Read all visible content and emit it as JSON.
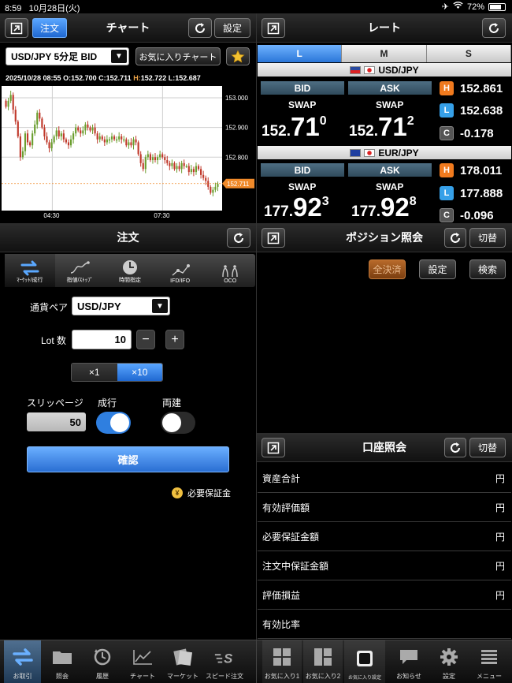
{
  "statusbar": {
    "time": "8:59",
    "date": "10月28日(火)",
    "battery": "72%"
  },
  "chart_panel": {
    "title": "チャート",
    "order_button": "注文",
    "settings_button": "設定",
    "symbol_select": "USD/JPY 5分足 BID",
    "favorite_button": "お気に入りチャート",
    "info": {
      "datetime": "2025/10/28 08:55",
      "o_label": "O:",
      "o_value": "152.700",
      "c_label": "C:",
      "c_value": "152.711",
      "h_label": "H:",
      "h_value": "152.722",
      "l_label": "L:",
      "l_value": "152.687"
    },
    "y_ticks": [
      "153.000",
      "152.900",
      "152.800"
    ],
    "x_ticks": [
      "04:30",
      "07:30"
    ],
    "current_price_tag": "152.711"
  },
  "chart_data": {
    "type": "candlestick",
    "x_ticks": [
      "04:30",
      "07:30"
    ],
    "y_ticks": [
      "153.000",
      "152.900",
      "152.800"
    ],
    "ylim": [
      152.62,
      153.04
    ],
    "current": 152.711,
    "closes": [
      152.97,
      152.99,
      153.01,
      152.96,
      152.92,
      152.87,
      152.8,
      152.82,
      152.88,
      152.85,
      152.84,
      152.88,
      152.91,
      152.95,
      152.93,
      152.9,
      152.87,
      152.85,
      152.83,
      152.85,
      152.87,
      152.89,
      152.87,
      152.88,
      152.86,
      152.85,
      152.84,
      152.86,
      152.88,
      152.9,
      152.89,
      152.88,
      152.89,
      152.91,
      152.9,
      152.89,
      152.9,
      152.88,
      152.86,
      152.87,
      152.86,
      152.85,
      152.86,
      152.86,
      152.87,
      152.86,
      152.86,
      152.87,
      152.86,
      152.86,
      152.84,
      152.85,
      152.84,
      152.86,
      152.85,
      152.81,
      152.78,
      152.76,
      152.8,
      152.81,
      152.79,
      152.8,
      152.79,
      152.8,
      152.81,
      152.8,
      152.79,
      152.78,
      152.77,
      152.78,
      152.76,
      152.77,
      152.76,
      152.78,
      152.77,
      152.77,
      152.75,
      152.76,
      152.75,
      152.77,
      152.76,
      152.74,
      152.73,
      152.72,
      152.7,
      152.68,
      152.69,
      152.7,
      152.71
    ]
  },
  "rate_panel": {
    "title": "レート",
    "tabs": [
      "L",
      "M",
      "S"
    ],
    "pairs": [
      {
        "name": "USD/JPY",
        "bid_label": "BID",
        "ask_label": "ASK",
        "swap_label": "SWAP",
        "bid": {
          "p1": "152.",
          "p2": "71",
          "p3": "0"
        },
        "ask": {
          "p1": "152.",
          "p2": "71",
          "p3": "2"
        },
        "high": "152.861",
        "low": "152.638",
        "change": "-0.178"
      },
      {
        "name": "EUR/JPY",
        "bid_label": "BID",
        "ask_label": "ASK",
        "swap_label": "SWAP",
        "bid": {
          "p1": "177.",
          "p2": "92",
          "p3": "3"
        },
        "ask": {
          "p1": "177.",
          "p2": "92",
          "p3": "8"
        },
        "high": "178.011",
        "low": "177.888",
        "change": "-0.096"
      }
    ],
    "badges": {
      "high": "H",
      "low": "L",
      "change": "C"
    },
    "colors": {
      "high": "#f07a1e",
      "low": "#36a0e8",
      "change": "#555555"
    }
  },
  "order_panel": {
    "title": "注文",
    "tabs": [
      "ﾏｰｹｯﾄ/成行",
      "指値/ｽﾄｯﾌﾟ",
      "時間指定",
      "IFD/IFO",
      "OCO"
    ],
    "currency_pair_label": "通貨ペア",
    "currency_pair_value": "USD/JPY",
    "lot_label": "Lot 数",
    "lot_value": "10",
    "minus": "−",
    "plus": "+",
    "multiplier": [
      "×1",
      "×10"
    ],
    "slippage_label": "スリッページ",
    "slippage_value": "50",
    "market_label": "成行",
    "market_on": true,
    "both_label": "両建",
    "both_on": false,
    "confirm_button": "確認",
    "margin_label": "必要保証金",
    "margin_icon": "¥"
  },
  "position_panel": {
    "title": "ポジション照会",
    "switch_button": "切替",
    "close_all_button": "全決済",
    "settings_button": "設定",
    "search_button": "検索"
  },
  "account_panel": {
    "title": "口座照会",
    "switch_button": "切替",
    "rows": [
      {
        "label": "資産合計",
        "unit": "円"
      },
      {
        "label": "有効評価額",
        "unit": "円"
      },
      {
        "label": "必要保証金額",
        "unit": "円"
      },
      {
        "label": "注文中保証金額",
        "unit": "円"
      },
      {
        "label": "評価損益",
        "unit": "円"
      },
      {
        "label": "有効比率",
        "unit": ""
      }
    ]
  },
  "bottombar": {
    "items": [
      {
        "label": "お取引",
        "icon": "order-arrows-icon"
      },
      {
        "label": "照会",
        "icon": "folder-icon"
      },
      {
        "label": "履歴",
        "icon": "history-clock-icon"
      },
      {
        "label": "チャート",
        "icon": "chart-line-icon"
      },
      {
        "label": "マーケット",
        "icon": "market-news-icon"
      },
      {
        "label": "スピード注文",
        "icon": "speed-order-icon"
      },
      {
        "label": "お気に入り1",
        "icon": "grid-four-icon"
      },
      {
        "label": "お気に入り2",
        "icon": "grid-two-icon"
      },
      {
        "label": "お気に入り設定",
        "icon": "favorite-settings-icon"
      },
      {
        "label": "お知らせ",
        "icon": "speech-bubble-icon"
      },
      {
        "label": "設定",
        "icon": "gear-icon"
      },
      {
        "label": "メニュー",
        "icon": "menu-list-icon"
      }
    ]
  }
}
